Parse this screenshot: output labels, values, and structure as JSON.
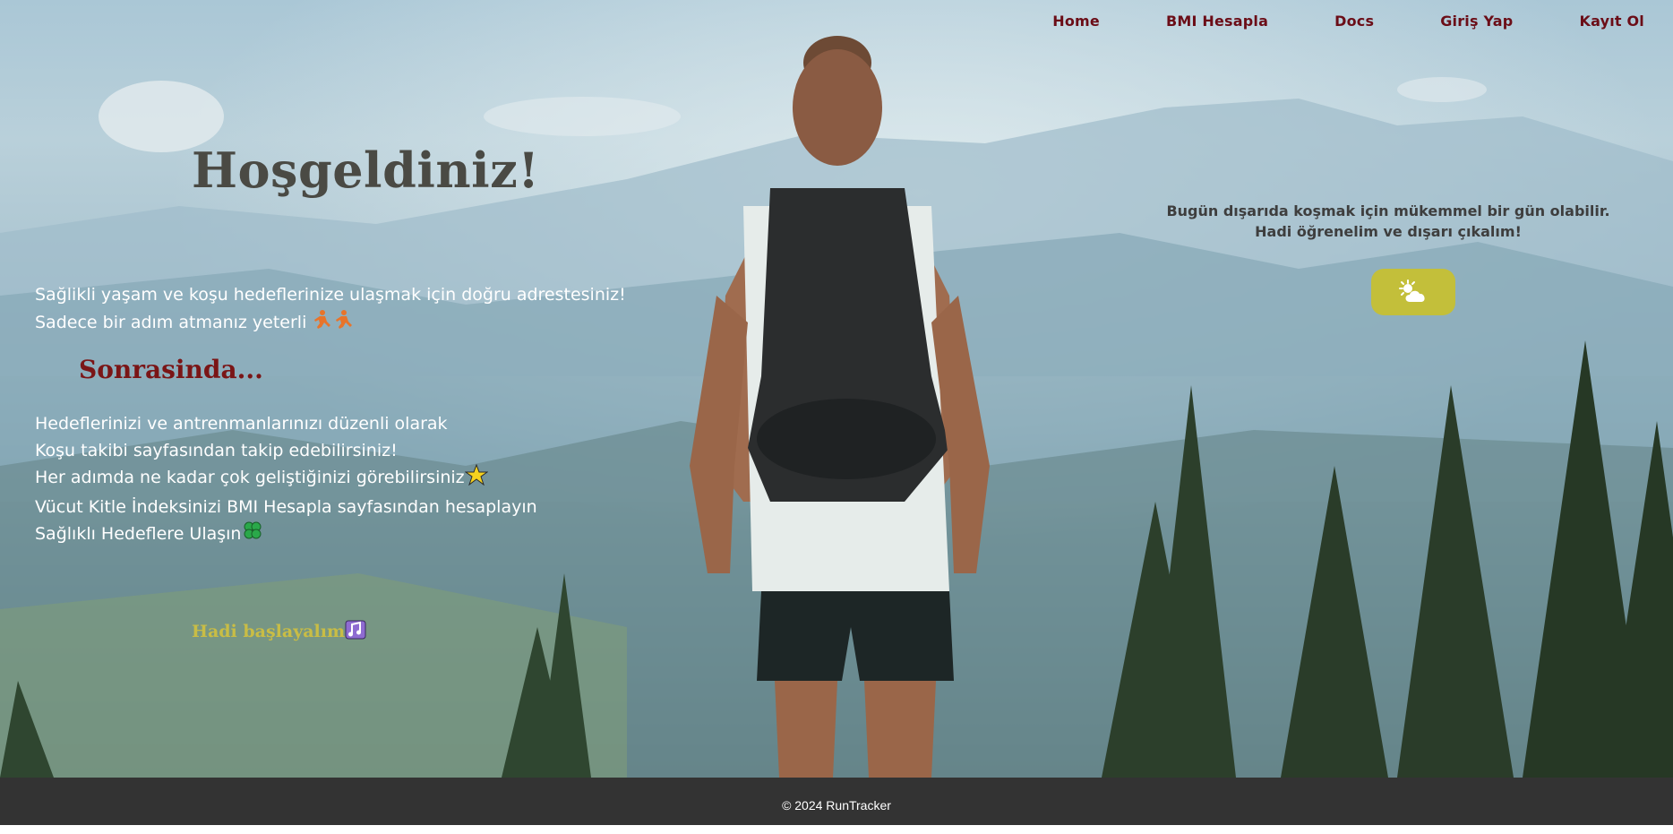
{
  "nav": {
    "items": [
      {
        "label": "Home"
      },
      {
        "label": "BMI Hesapla"
      },
      {
        "label": "Docs"
      },
      {
        "label": "Giriş Yap"
      },
      {
        "label": "Kayıt Ol"
      }
    ]
  },
  "hero": {
    "title": "Hoşgeldiniz!",
    "intro_line1": "Sağlikli yaşam ve koşu hedeflerinize ulaşmak için doğru adrestesiniz!",
    "intro_line2": "Sadece bir adım atmanız yeterli",
    "subtitle": "Sonrasinda...",
    "detail_lines": [
      "Hedeflerinizi ve antrenmanlarınızı düzenli olarak",
      "Koşu takibi sayfasından takip edebilirsiniz!",
      "Her adımda ne kadar çok geliştiğinizi görebilirsiniz",
      "Vücut Kitle İndeksinizi BMI Hesapla sayfasından hesaplayın",
      "Sağlıklı Hedeflere Ulaşın"
    ],
    "cta": "Hadi başlayalım"
  },
  "weather": {
    "line1": "Bugün dışarıda koşmak için mükemmel bir gün olabilir.",
    "line2": "Hadi öğrenelim ve dışarı çıkalım!",
    "button_icon": "sun-behind-cloud-icon"
  },
  "footer": {
    "text": "© 2024 RunTracker"
  },
  "colors": {
    "nav_link": "#6b0d17",
    "subtitle": "#7a1516",
    "cta": "#c9bd45",
    "weather_button": "#c3bf3a",
    "footer_bg": "#333333"
  }
}
